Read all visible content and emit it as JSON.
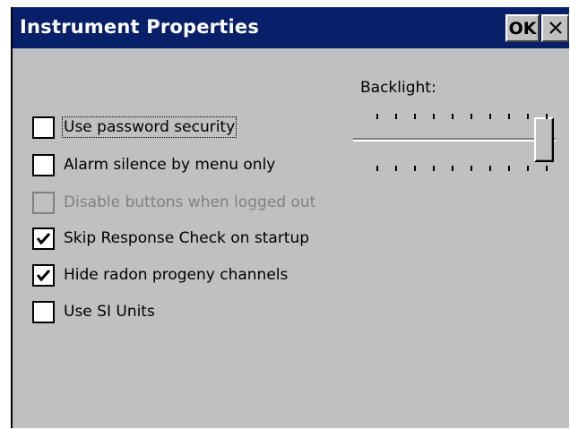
{
  "window": {
    "title": "Instrument Properties",
    "ok_label": "OK",
    "close_glyph": "✕"
  },
  "options": [
    {
      "label": "Use password security",
      "checked": false,
      "enabled": true,
      "focused": true
    },
    {
      "label": "Alarm silence by menu only",
      "checked": false,
      "enabled": true,
      "focused": false
    },
    {
      "label": "Disable buttons when logged out",
      "checked": false,
      "enabled": false,
      "focused": false
    },
    {
      "label": "Skip Response Check on startup",
      "checked": true,
      "enabled": true,
      "focused": false
    },
    {
      "label": "Hide radon progeny channels",
      "checked": true,
      "enabled": true,
      "focused": false
    },
    {
      "label": "Use SI Units",
      "checked": false,
      "enabled": true,
      "focused": false
    }
  ],
  "backlight": {
    "label": "Backlight:",
    "level": 1.0,
    "tick_count": 10
  },
  "colors": {
    "titlebar": "#08206a",
    "face": "#c0c0c0",
    "disabled_text": "#808080"
  }
}
